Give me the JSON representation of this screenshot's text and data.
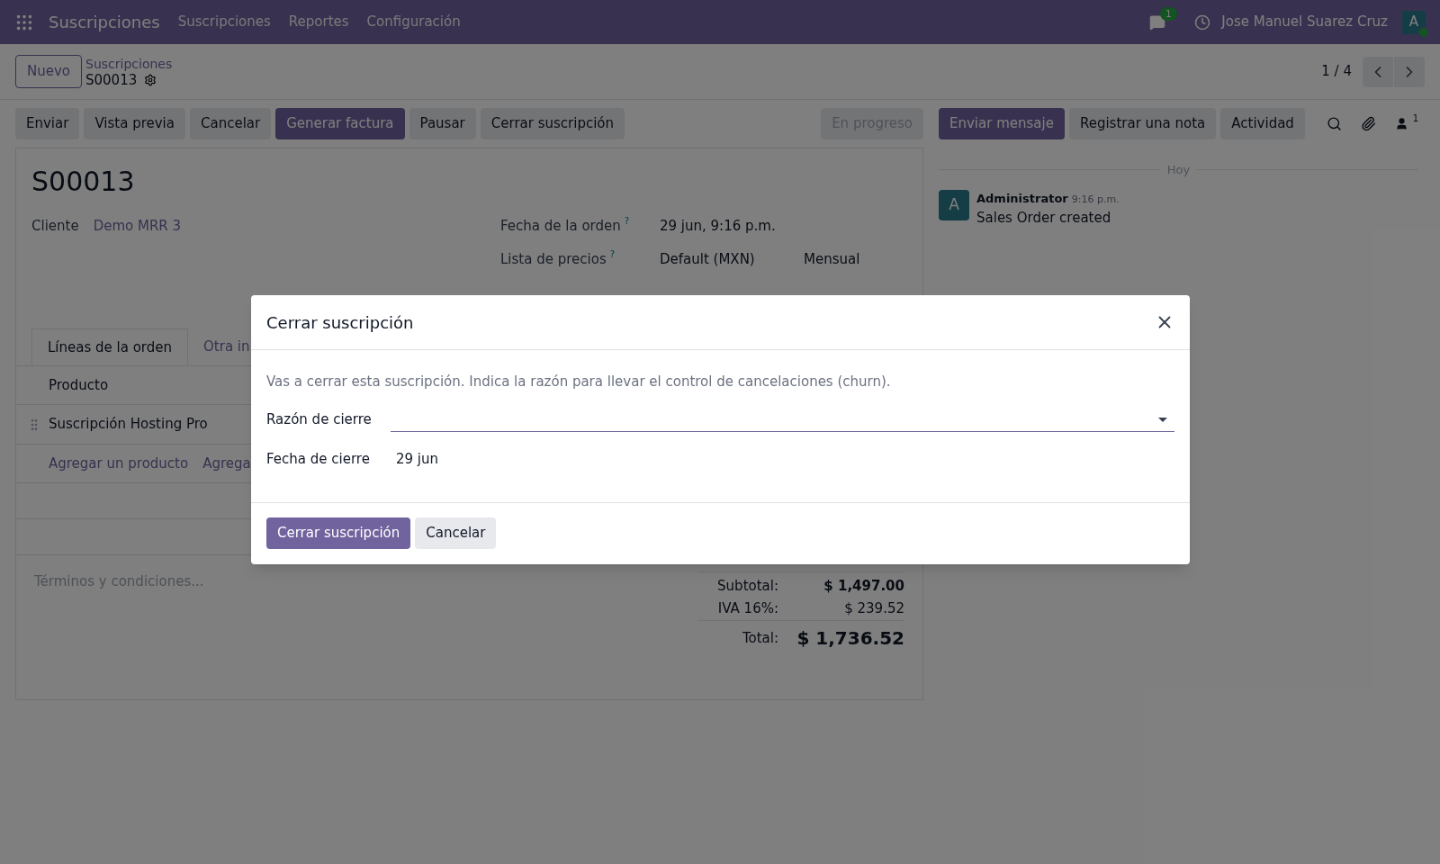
{
  "navbar": {
    "app_name": "Suscripciones",
    "menus": [
      "Suscripciones",
      "Reportes",
      "Configuración"
    ],
    "messages_count": "1",
    "user_name": "Jose Manuel Suarez Cruz",
    "avatar_letter": "A"
  },
  "control_panel": {
    "new_button": "Nuevo",
    "breadcrumb": "Suscripciones",
    "record": "S00013",
    "pager": "1 / 4"
  },
  "actions": [
    {
      "label": "Enviar",
      "primary": false
    },
    {
      "label": "Vista previa",
      "primary": false
    },
    {
      "label": "Cancelar",
      "primary": false
    },
    {
      "label": "Generar factura",
      "primary": true
    },
    {
      "label": "Pausar",
      "primary": false
    },
    {
      "label": "Cerrar suscripción",
      "primary": false
    }
  ],
  "status": "En progreso",
  "form": {
    "title": "S00013",
    "customer_label": "Cliente",
    "customer": "Demo MRR 3",
    "fields": [
      {
        "label": "Fecha de la orden",
        "help": "?",
        "values": [
          "29 jun, 9:16 p.m."
        ]
      },
      {
        "label": "Lista de precios",
        "help": "?",
        "values": [
          "Default (MXN)",
          "Mensual"
        ]
      }
    ],
    "tabs": [
      {
        "label": "Líneas de la orden",
        "selected": true
      },
      {
        "label": "Otra in",
        "selected": false
      }
    ],
    "table": {
      "columns": [
        "Producto"
      ],
      "rows": [
        [
          "Suscripción Hosting Pro"
        ]
      ],
      "add_links": [
        "Agregar un producto",
        "Agrega"
      ]
    },
    "terms_placeholder": "Términos y condiciones...",
    "totals": [
      {
        "label": "Subtotal:",
        "value": "$ 1,497.00",
        "kind": "subtotal"
      },
      {
        "label": "IVA 16%:",
        "value": "$ 239.52",
        "kind": "tax"
      },
      {
        "label": "Total:",
        "value": "$ 1,736.52",
        "kind": "total"
      }
    ]
  },
  "chatter": {
    "buttons": [
      {
        "label": "Enviar mensaje",
        "primary": true
      },
      {
        "label": "Registrar una nota",
        "primary": false
      },
      {
        "label": "Actividad",
        "primary": false
      }
    ],
    "followers_count": "1",
    "day": "Hoy",
    "messages": [
      {
        "avatar": "A",
        "author": "Administrator",
        "time": "9:16 p.m.",
        "body": "Sales Order created"
      }
    ]
  },
  "dialog": {
    "title": "Cerrar suscripción",
    "text": "Vas a cerrar esta suscripción. Indica la razón para llevar el control de cancelaciones (churn).",
    "fields": [
      {
        "label": "Razón de cierre",
        "kind": "select"
      },
      {
        "label": "Fecha de cierre",
        "kind": "date",
        "value": "29 jun"
      }
    ],
    "buttons": [
      {
        "label": "Cerrar suscripción",
        "primary": true
      },
      {
        "label": "Cancelar",
        "primary": false
      }
    ]
  }
}
